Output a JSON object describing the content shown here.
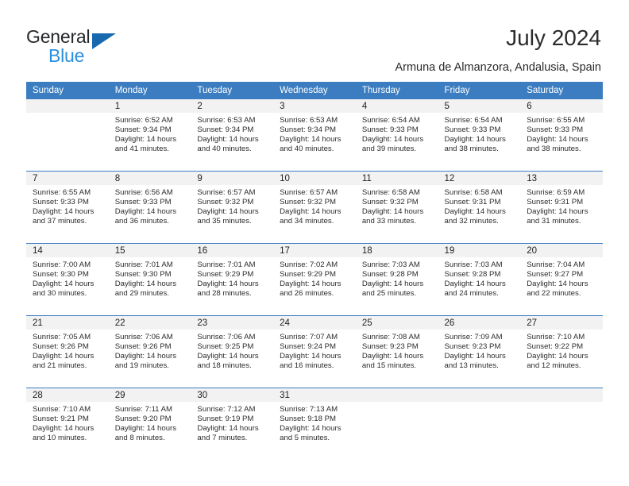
{
  "brand": {
    "name_primary": "General",
    "name_secondary": "Blue",
    "triangle_color": "#1868b0",
    "blue_text_color": "#2b8ede"
  },
  "header": {
    "title": "July 2024",
    "location": "Armuna de Almanzora, Andalusia, Spain",
    "header_bg_color": "#3b7dc0",
    "daynum_band_color": "#f2f2f2"
  },
  "weekday_headers": [
    "Sunday",
    "Monday",
    "Tuesday",
    "Wednesday",
    "Thursday",
    "Friday",
    "Saturday"
  ],
  "weeks": [
    [
      {
        "day": "",
        "sunrise": "",
        "sunset": "",
        "daylight_line1": "",
        "daylight_line2": ""
      },
      {
        "day": "1",
        "sunrise": "Sunrise: 6:52 AM",
        "sunset": "Sunset: 9:34 PM",
        "daylight_line1": "Daylight: 14 hours",
        "daylight_line2": "and 41 minutes."
      },
      {
        "day": "2",
        "sunrise": "Sunrise: 6:53 AM",
        "sunset": "Sunset: 9:34 PM",
        "daylight_line1": "Daylight: 14 hours",
        "daylight_line2": "and 40 minutes."
      },
      {
        "day": "3",
        "sunrise": "Sunrise: 6:53 AM",
        "sunset": "Sunset: 9:34 PM",
        "daylight_line1": "Daylight: 14 hours",
        "daylight_line2": "and 40 minutes."
      },
      {
        "day": "4",
        "sunrise": "Sunrise: 6:54 AM",
        "sunset": "Sunset: 9:33 PM",
        "daylight_line1": "Daylight: 14 hours",
        "daylight_line2": "and 39 minutes."
      },
      {
        "day": "5",
        "sunrise": "Sunrise: 6:54 AM",
        "sunset": "Sunset: 9:33 PM",
        "daylight_line1": "Daylight: 14 hours",
        "daylight_line2": "and 38 minutes."
      },
      {
        "day": "6",
        "sunrise": "Sunrise: 6:55 AM",
        "sunset": "Sunset: 9:33 PM",
        "daylight_line1": "Daylight: 14 hours",
        "daylight_line2": "and 38 minutes."
      }
    ],
    [
      {
        "day": "7",
        "sunrise": "Sunrise: 6:55 AM",
        "sunset": "Sunset: 9:33 PM",
        "daylight_line1": "Daylight: 14 hours",
        "daylight_line2": "and 37 minutes."
      },
      {
        "day": "8",
        "sunrise": "Sunrise: 6:56 AM",
        "sunset": "Sunset: 9:33 PM",
        "daylight_line1": "Daylight: 14 hours",
        "daylight_line2": "and 36 minutes."
      },
      {
        "day": "9",
        "sunrise": "Sunrise: 6:57 AM",
        "sunset": "Sunset: 9:32 PM",
        "daylight_line1": "Daylight: 14 hours",
        "daylight_line2": "and 35 minutes."
      },
      {
        "day": "10",
        "sunrise": "Sunrise: 6:57 AM",
        "sunset": "Sunset: 9:32 PM",
        "daylight_line1": "Daylight: 14 hours",
        "daylight_line2": "and 34 minutes."
      },
      {
        "day": "11",
        "sunrise": "Sunrise: 6:58 AM",
        "sunset": "Sunset: 9:32 PM",
        "daylight_line1": "Daylight: 14 hours",
        "daylight_line2": "and 33 minutes."
      },
      {
        "day": "12",
        "sunrise": "Sunrise: 6:58 AM",
        "sunset": "Sunset: 9:31 PM",
        "daylight_line1": "Daylight: 14 hours",
        "daylight_line2": "and 32 minutes."
      },
      {
        "day": "13",
        "sunrise": "Sunrise: 6:59 AM",
        "sunset": "Sunset: 9:31 PM",
        "daylight_line1": "Daylight: 14 hours",
        "daylight_line2": "and 31 minutes."
      }
    ],
    [
      {
        "day": "14",
        "sunrise": "Sunrise: 7:00 AM",
        "sunset": "Sunset: 9:30 PM",
        "daylight_line1": "Daylight: 14 hours",
        "daylight_line2": "and 30 minutes."
      },
      {
        "day": "15",
        "sunrise": "Sunrise: 7:01 AM",
        "sunset": "Sunset: 9:30 PM",
        "daylight_line1": "Daylight: 14 hours",
        "daylight_line2": "and 29 minutes."
      },
      {
        "day": "16",
        "sunrise": "Sunrise: 7:01 AM",
        "sunset": "Sunset: 9:29 PM",
        "daylight_line1": "Daylight: 14 hours",
        "daylight_line2": "and 28 minutes."
      },
      {
        "day": "17",
        "sunrise": "Sunrise: 7:02 AM",
        "sunset": "Sunset: 9:29 PM",
        "daylight_line1": "Daylight: 14 hours",
        "daylight_line2": "and 26 minutes."
      },
      {
        "day": "18",
        "sunrise": "Sunrise: 7:03 AM",
        "sunset": "Sunset: 9:28 PM",
        "daylight_line1": "Daylight: 14 hours",
        "daylight_line2": "and 25 minutes."
      },
      {
        "day": "19",
        "sunrise": "Sunrise: 7:03 AM",
        "sunset": "Sunset: 9:28 PM",
        "daylight_line1": "Daylight: 14 hours",
        "daylight_line2": "and 24 minutes."
      },
      {
        "day": "20",
        "sunrise": "Sunrise: 7:04 AM",
        "sunset": "Sunset: 9:27 PM",
        "daylight_line1": "Daylight: 14 hours",
        "daylight_line2": "and 22 minutes."
      }
    ],
    [
      {
        "day": "21",
        "sunrise": "Sunrise: 7:05 AM",
        "sunset": "Sunset: 9:26 PM",
        "daylight_line1": "Daylight: 14 hours",
        "daylight_line2": "and 21 minutes."
      },
      {
        "day": "22",
        "sunrise": "Sunrise: 7:06 AM",
        "sunset": "Sunset: 9:26 PM",
        "daylight_line1": "Daylight: 14 hours",
        "daylight_line2": "and 19 minutes."
      },
      {
        "day": "23",
        "sunrise": "Sunrise: 7:06 AM",
        "sunset": "Sunset: 9:25 PM",
        "daylight_line1": "Daylight: 14 hours",
        "daylight_line2": "and 18 minutes."
      },
      {
        "day": "24",
        "sunrise": "Sunrise: 7:07 AM",
        "sunset": "Sunset: 9:24 PM",
        "daylight_line1": "Daylight: 14 hours",
        "daylight_line2": "and 16 minutes."
      },
      {
        "day": "25",
        "sunrise": "Sunrise: 7:08 AM",
        "sunset": "Sunset: 9:23 PM",
        "daylight_line1": "Daylight: 14 hours",
        "daylight_line2": "and 15 minutes."
      },
      {
        "day": "26",
        "sunrise": "Sunrise: 7:09 AM",
        "sunset": "Sunset: 9:23 PM",
        "daylight_line1": "Daylight: 14 hours",
        "daylight_line2": "and 13 minutes."
      },
      {
        "day": "27",
        "sunrise": "Sunrise: 7:10 AM",
        "sunset": "Sunset: 9:22 PM",
        "daylight_line1": "Daylight: 14 hours",
        "daylight_line2": "and 12 minutes."
      }
    ],
    [
      {
        "day": "28",
        "sunrise": "Sunrise: 7:10 AM",
        "sunset": "Sunset: 9:21 PM",
        "daylight_line1": "Daylight: 14 hours",
        "daylight_line2": "and 10 minutes."
      },
      {
        "day": "29",
        "sunrise": "Sunrise: 7:11 AM",
        "sunset": "Sunset: 9:20 PM",
        "daylight_line1": "Daylight: 14 hours",
        "daylight_line2": "and 8 minutes."
      },
      {
        "day": "30",
        "sunrise": "Sunrise: 7:12 AM",
        "sunset": "Sunset: 9:19 PM",
        "daylight_line1": "Daylight: 14 hours",
        "daylight_line2": "and 7 minutes."
      },
      {
        "day": "31",
        "sunrise": "Sunrise: 7:13 AM",
        "sunset": "Sunset: 9:18 PM",
        "daylight_line1": "Daylight: 14 hours",
        "daylight_line2": "and 5 minutes."
      },
      {
        "day": "",
        "sunrise": "",
        "sunset": "",
        "daylight_line1": "",
        "daylight_line2": ""
      },
      {
        "day": "",
        "sunrise": "",
        "sunset": "",
        "daylight_line1": "",
        "daylight_line2": ""
      },
      {
        "day": "",
        "sunrise": "",
        "sunset": "",
        "daylight_line1": "",
        "daylight_line2": ""
      }
    ]
  ]
}
